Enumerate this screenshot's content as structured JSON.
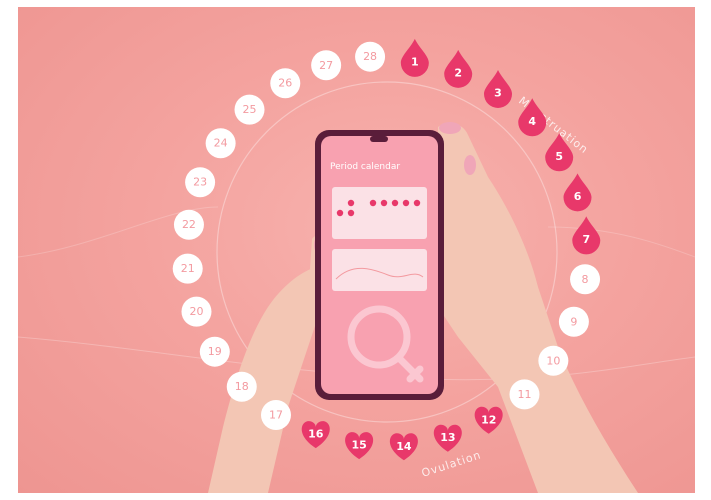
{
  "colors": {
    "background": "#f4a39f",
    "drop": "#e8386a",
    "heart": "#e8386a",
    "white_marker": "#ffffff",
    "white_marker_text": "#f39aa0",
    "phone_frame": "#5a1d3a",
    "phone_screen": "#f8a1b0"
  },
  "menstruation_days": [
    "1",
    "2",
    "3",
    "4",
    "5",
    "6",
    "7"
  ],
  "fertile_days": [
    "12",
    "13",
    "14",
    "15",
    "16"
  ],
  "other_days": [
    "8",
    "9",
    "10",
    "11",
    "17",
    "18",
    "19",
    "20",
    "21",
    "22",
    "23",
    "24",
    "25",
    "26",
    "27",
    "28"
  ],
  "phone_screen": {
    "title": "Period calendar",
    "symbol": "female-symbol-icon"
  },
  "curve_labels": [
    "Menstruation",
    "Ovulation"
  ]
}
